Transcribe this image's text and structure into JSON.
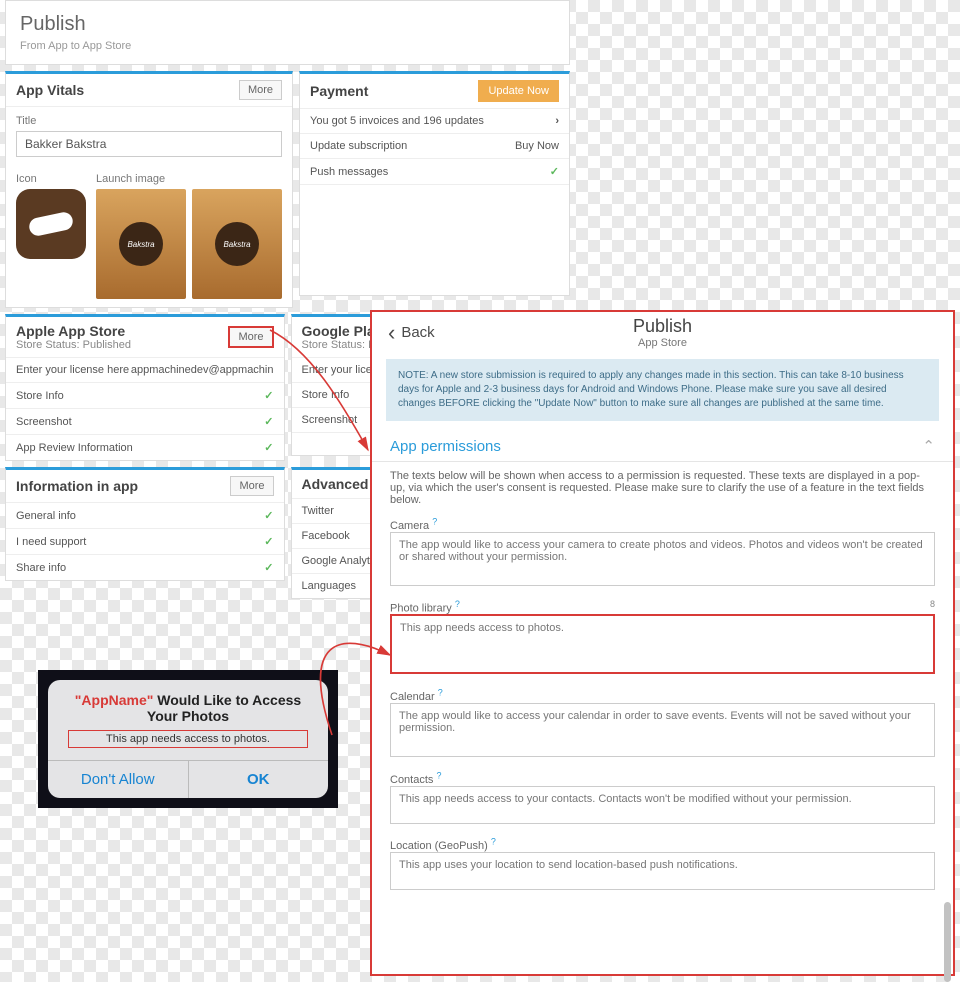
{
  "header": {
    "title": "Publish",
    "subtitle": "From App to App Store"
  },
  "vitals": {
    "heading": "App Vitals",
    "more": "More",
    "title_label": "Title",
    "title_value": "Bakker Bakstra",
    "icon_label": "Icon",
    "launch_label": "Launch image",
    "launch_badge": "Bakstra"
  },
  "payment": {
    "heading": "Payment",
    "update": "Update Now",
    "row1": "You got 5 invoices and 196 updates",
    "row2_l": "Update subscription",
    "row2_r": "Buy Now",
    "row3": "Push messages"
  },
  "apple": {
    "heading": "Apple App Store",
    "status": "Store Status: Published",
    "more": "More",
    "row1_l": "Enter your license here",
    "row1_r": "appmachinedev@appmachin",
    "row2": "Store Info",
    "row3": "Screenshot",
    "row4": "App Review Information"
  },
  "google": {
    "heading": "Google Play",
    "status": "Store Status: Pub",
    "row1": "Enter your licen",
    "row2": "Store Info",
    "row3": "Screenshot"
  },
  "info": {
    "heading": "Information in app",
    "more": "More",
    "row1": "General info",
    "row2": "I need support",
    "row3": "Share info"
  },
  "advanced": {
    "heading": "Advanced",
    "row1": "Twitter",
    "row2": "Facebook",
    "row3": "Google Analytics",
    "row4": "Languages"
  },
  "pp": {
    "back": "Back",
    "title": "Publish",
    "sub": "App Store",
    "note": "NOTE: A new store submission is required to apply any changes made in this section. This can take 8-10 business days for Apple and 2-3 business days for Android and Windows Phone. Please make sure you save all desired changes BEFORE clicking the \"Update Now\" button to make sure all changes are published at the same time.",
    "section": "App permissions",
    "intro": "The texts below will be shown when access to a permission is requested. These texts are displayed in a pop-up, via which the user's consent is requested. Please make sure to clarify the use of a feature in the text fields below.",
    "camera_lbl": "Camera",
    "camera_val": "The app would like to access your camera to create photos and videos. Photos and videos won't be created or shared without your permission.",
    "photo_lbl": "Photo library",
    "photo_val": "This app needs access to photos.",
    "cal_lbl": "Calendar",
    "cal_val": "The app would like to access your calendar in order to save events. Events will not be saved without your permission.",
    "contacts_lbl": "Contacts",
    "contacts_val": "This app needs access to your contacts. Contacts won't be modified without your permission.",
    "loc_lbl": "Location (GeoPush)",
    "loc_val": "This app uses your location to send location-based push notifications."
  },
  "ios": {
    "app": "\"AppName\"",
    "rest": "  Would Like to Access Your Photos",
    "msg": "This app needs access to photos.",
    "deny": "Don't Allow",
    "ok": "OK"
  }
}
